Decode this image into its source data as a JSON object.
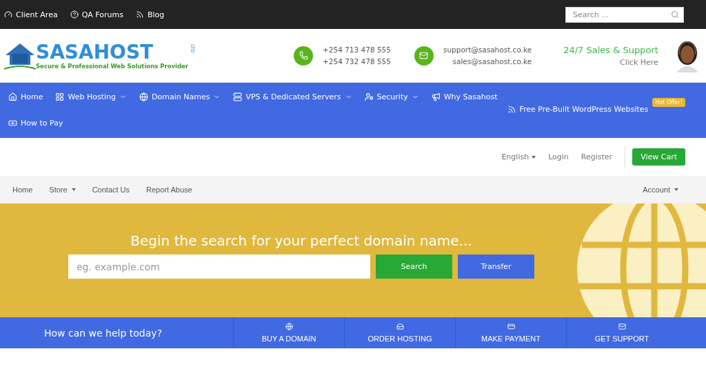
{
  "top_bar": {
    "links": [
      {
        "label": "Client Area"
      },
      {
        "label": "QA Forums"
      },
      {
        "label": "Blog"
      }
    ],
    "search": {
      "placeholder": "Search ..."
    }
  },
  "header": {
    "logo": {
      "name": "SASAHOST",
      "suffix": "LTD",
      "tagline": "Secure & Professional Web Solutions Provider"
    },
    "phones": [
      "+254 713 478 555",
      "+254 732 478 555"
    ],
    "emails": [
      "support@sasahost.co.ke",
      "sales@sasahost.co.ke"
    ],
    "support": {
      "title": "24/7 Sales & Support",
      "link": "Click Here"
    }
  },
  "main_nav": {
    "items": [
      {
        "label": "Home",
        "dropdown": false
      },
      {
        "label": "Web Hosting",
        "dropdown": true
      },
      {
        "label": "Domain Names",
        "dropdown": true
      },
      {
        "label": "VPS & Dedicated Servers",
        "dropdown": true
      },
      {
        "label": "Security",
        "dropdown": true
      },
      {
        "label": "Why Sasahost",
        "dropdown": false
      },
      {
        "label": "Free Pre-Built WordPress Websites",
        "dropdown": false,
        "badge": "Hot Offer!"
      },
      {
        "label": "How to Pay",
        "dropdown": false
      }
    ]
  },
  "account_bar": {
    "language": "English",
    "links": [
      "Login",
      "Register"
    ],
    "cart_button": "View Cart"
  },
  "store_nav": {
    "items": [
      {
        "label": "Home",
        "dropdown": false
      },
      {
        "label": "Store",
        "dropdown": true
      },
      {
        "label": "Contact Us",
        "dropdown": false
      },
      {
        "label": "Report Abuse",
        "dropdown": false
      }
    ],
    "account": "Account"
  },
  "hero": {
    "title": "Begin the search for your perfect domain name...",
    "placeholder": "eg. example.com",
    "buttons": [
      {
        "label": "Search",
        "kind": "search"
      },
      {
        "label": "Transfer",
        "kind": "transfer"
      }
    ]
  },
  "help_bar": {
    "title": "How can we help today?",
    "actions": [
      {
        "label": "BUY A DOMAIN"
      },
      {
        "label": "ORDER HOSTING"
      },
      {
        "label": "MAKE PAYMENT"
      },
      {
        "label": "GET SUPPORT"
      }
    ]
  }
}
